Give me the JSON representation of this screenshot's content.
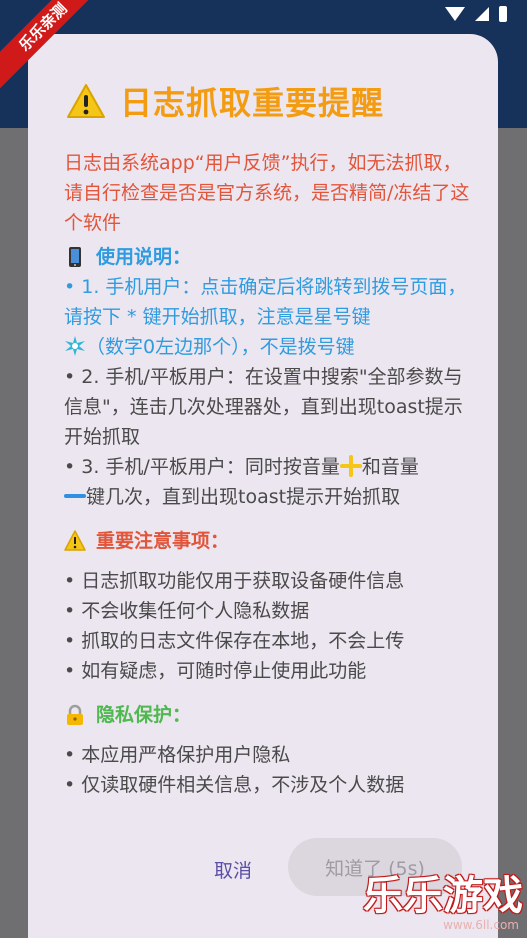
{
  "corner_badge": "乐乐亲测",
  "dialog": {
    "title": "日志抓取重要提醒",
    "intro": "日志由系统app“用户反馈”执行，如无法抓取，请自行检查是否是官方系统，是否精简/冻结了这个软件",
    "usage": {
      "heading": "使用说明：",
      "item1_a": "• 1. 手机用户：点击确定后将跳转到拨号页面，请按下 * 键开始抓取，注意是星号键",
      "item1_b": "（数字0左边那个），不是拨号键",
      "item2": "• 2. 手机/平板用户：在设置中搜索\"全部参数与信息\"，连击几次处理器处，直到出现toast提示开始抓取",
      "item3_a": "• 3. 手机/平板用户：同时按音量",
      "item3_b": "和音量",
      "item3_c": "键几次，直到出现toast提示开始抓取"
    },
    "notice": {
      "heading": "重要注意事项：",
      "items": [
        "• 日志抓取功能仅用于获取设备硬件信息",
        "• 不会收集任何个人隐私数据",
        "• 抓取的日志文件保存在本地，不会上传",
        "• 如有疑虑，可随时停止使用此功能"
      ]
    },
    "privacy": {
      "heading": "隐私保护：",
      "items": [
        "• 本应用严格保护用户隐私",
        "• 仅读取硬件相关信息，不涉及个人数据"
      ]
    },
    "cancel_label": "取消",
    "confirm_label": "知道了 (5s)"
  },
  "watermark": {
    "text": "乐乐游戏",
    "url": "www.6ll.com"
  },
  "colors": {
    "title": "#f39c12",
    "intro": "#e2553a",
    "usage": "#2f9ce0",
    "privacy": "#4fb84f",
    "dialog_bg": "#ece6f0",
    "header": "#17325a"
  }
}
